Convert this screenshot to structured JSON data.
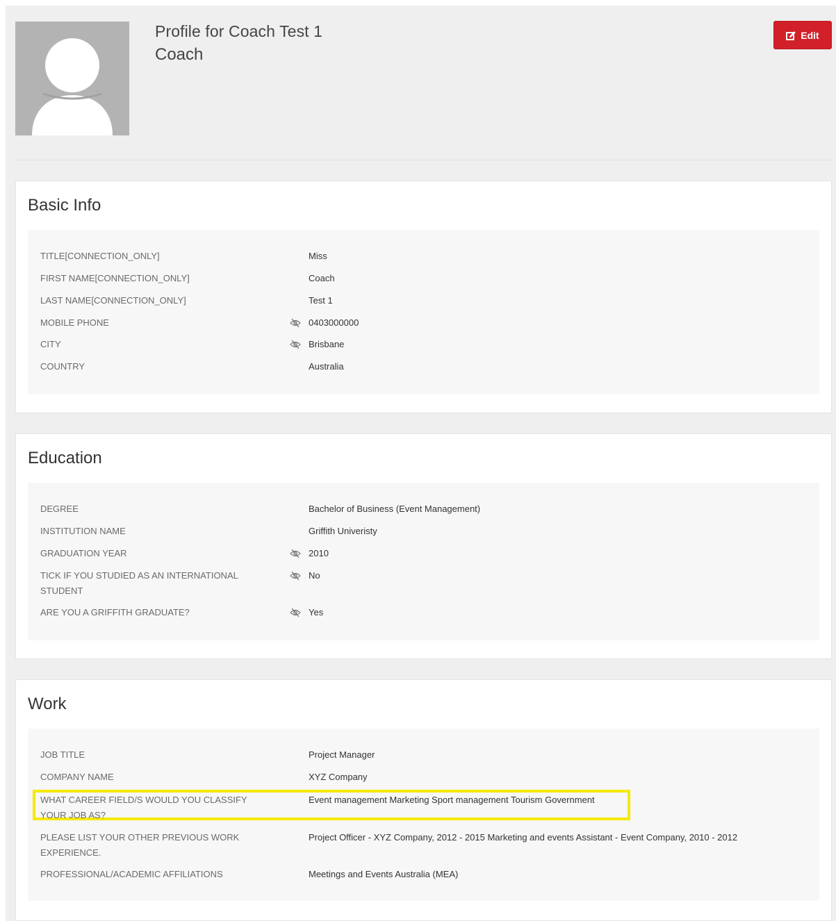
{
  "header": {
    "profile_title": "Profile for Coach Test 1",
    "role": "Coach",
    "edit_label": "Edit",
    "accent_color": "#d1202a"
  },
  "basic_info": {
    "title": "Basic Info",
    "rows": [
      {
        "label": "TITLE[CONNECTION_ONLY]",
        "value": "Miss",
        "private": false
      },
      {
        "label": "FIRST NAME[CONNECTION_ONLY]",
        "value": "Coach",
        "private": false
      },
      {
        "label": "LAST NAME[CONNECTION_ONLY]",
        "value": "Test 1",
        "private": false
      },
      {
        "label": "MOBILE PHONE",
        "value": "0403000000",
        "private": true
      },
      {
        "label": "CITY",
        "value": "Brisbane",
        "private": true
      },
      {
        "label": "COUNTRY",
        "value": "Australia",
        "private": false
      }
    ]
  },
  "education": {
    "title": "Education",
    "rows": [
      {
        "label": "DEGREE",
        "value": "Bachelor of Business (Event Management)",
        "private": false
      },
      {
        "label": "INSTITUTION NAME",
        "value": "Griffith Univeristy",
        "private": false
      },
      {
        "label": "GRADUATION YEAR",
        "value": "2010",
        "private": true
      },
      {
        "label_line1": "TICK IF YOU STUDIED AS AN INTERNATIONAL",
        "label_line2": "STUDENT",
        "value": "No",
        "private": true
      },
      {
        "label": "ARE YOU A GRIFFITH GRADUATE?",
        "value": "Yes",
        "private": true
      }
    ]
  },
  "work": {
    "title": "Work",
    "rows": [
      {
        "label": "JOB TITLE",
        "value": "Project Manager",
        "private": false
      },
      {
        "label": "COMPANY NAME",
        "value": "XYZ Company",
        "private": false
      },
      {
        "label_line1": "WHAT CAREER FIELD/S WOULD YOU CLASSIFY",
        "label_line2": "YOUR JOB AS?",
        "value": "Event management Marketing Sport management Tourism Government",
        "private": false,
        "highlighted": true
      },
      {
        "label_line1": "PLEASE LIST YOUR OTHER PREVIOUS WORK",
        "label_line2": "EXPERIENCE.",
        "value": "Project Officer - XYZ Company, 2012 - 2015 Marketing and events Assistant - Event Company, 2010 - 2012",
        "private": false
      },
      {
        "label": "PROFESSIONAL/ACADEMIC AFFILIATIONS",
        "value": "Meetings and Events Australia (MEA)",
        "private": false
      }
    ]
  },
  "icons": {
    "privacy": "eye-slash-icon",
    "edit": "edit-icon",
    "highlight_color": "#f5ea00"
  }
}
